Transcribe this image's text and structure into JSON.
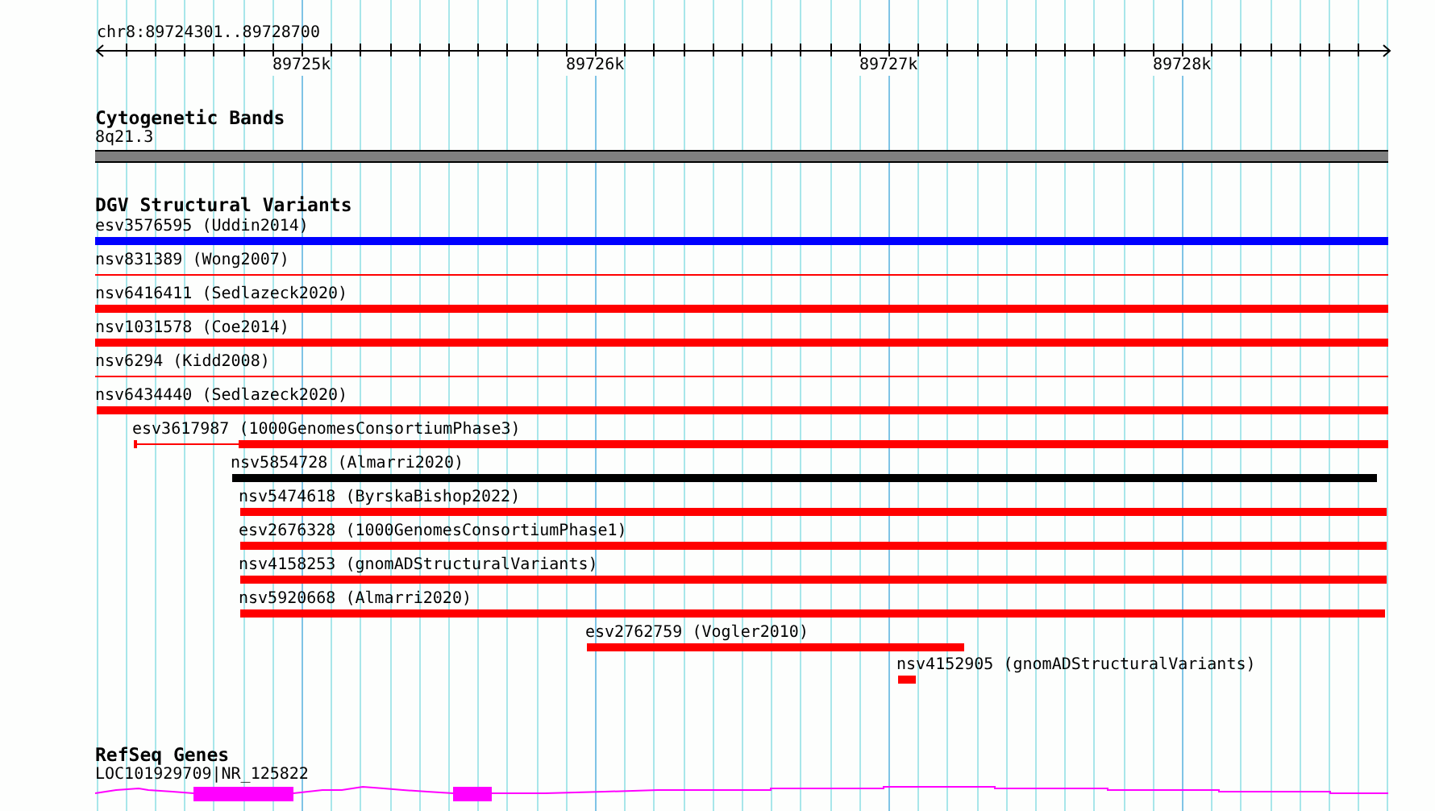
{
  "ruler": {
    "location": "chr8:89724301..89728700",
    "ticks": [
      "89725k",
      "89726k",
      "89727k",
      "89728k"
    ]
  },
  "tracks": [
    {
      "kind": "cytoband",
      "title": "Cytogenetic Bands",
      "label": "8q21.3"
    },
    {
      "kind": "variants",
      "title": "DGV Structural Variants",
      "features": [
        {
          "label": "esv3576595 (Uddin2014)",
          "kind": "bar",
          "color": "#0000ff"
        },
        {
          "label": "nsv831389 (Wong2007)",
          "kind": "line",
          "color": "#ff0000"
        },
        {
          "label": "nsv6416411 (Sedlazeck2020)",
          "kind": "bar",
          "color": "#ff0000"
        },
        {
          "label": "nsv1031578 (Coe2014)",
          "kind": "bar",
          "color": "#ff0000"
        },
        {
          "label": "nsv6294 (Kidd2008)",
          "kind": "line",
          "color": "#ff0000"
        },
        {
          "label": "nsv6434440 (Sedlazeck2020)",
          "kind": "bar",
          "color": "#ff0000"
        },
        {
          "label": "esv3617987 (1000GenomesConsortiumPhase3)",
          "kind": "split",
          "color": "#ff0000"
        },
        {
          "label": "nsv5854728 (Almarri2020)",
          "kind": "bar",
          "color": "#000000"
        },
        {
          "label": "nsv5474618 (ByrskaBishop2022)",
          "kind": "bar",
          "color": "#ff0000"
        },
        {
          "label": "esv2676328 (1000GenomesConsortiumPhase1)",
          "kind": "bar",
          "color": "#ff0000"
        },
        {
          "label": "nsv4158253 (gnomADStructuralVariants)",
          "kind": "bar",
          "color": "#ff0000"
        },
        {
          "label": "nsv5920668 (Almarri2020)",
          "kind": "bar",
          "color": "#ff0000"
        },
        {
          "label": "esv2762759 (Vogler2010)",
          "kind": "bar",
          "color": "#ff0000"
        },
        {
          "label": "nsv4152905 (gnomADStructuralVariants)",
          "kind": "bar",
          "color": "#ff0000"
        }
      ]
    },
    {
      "kind": "genes",
      "title": "RefSeq Genes",
      "label": "LOC101929709|NR_125822"
    }
  ]
}
